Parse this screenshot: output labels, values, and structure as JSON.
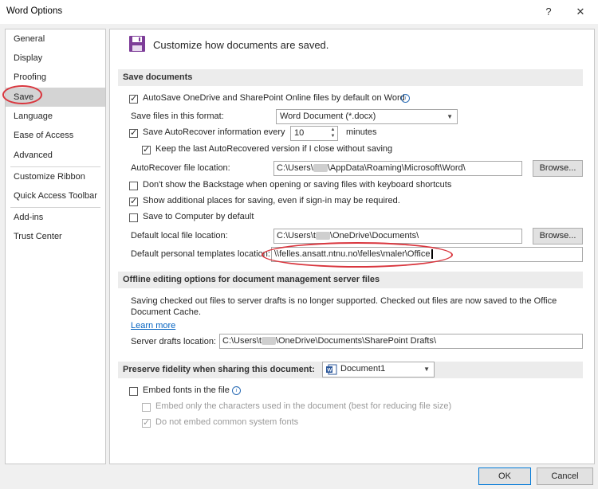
{
  "window": {
    "title": "Word Options",
    "help_glyph": "?",
    "close_glyph": "✕"
  },
  "nav": {
    "items": [
      "General",
      "Display",
      "Proofing",
      "Save",
      "Language",
      "Ease of Access",
      "Advanced",
      "Customize Ribbon",
      "Quick Access Toolbar",
      "Add-ins",
      "Trust Center"
    ],
    "selected": "Save"
  },
  "header": {
    "text": "Customize how documents are saved."
  },
  "save_documents": {
    "section_title": "Save documents",
    "autosave_label": "AutoSave OneDrive and SharePoint Online files by default on Word",
    "format_label": "Save files in this format:",
    "format_value": "Word Document (*.docx)",
    "autorecover_label": "Save AutoRecover information every",
    "autorecover_minutes": "10",
    "minutes_label": "minutes",
    "keep_last_label": "Keep the last AutoRecovered version if I close without saving",
    "autorecover_location_label": "AutoRecover file location:",
    "autorecover_location_prefix": "C:\\Users\\",
    "autorecover_location_suffix": "\\AppData\\Roaming\\Microsoft\\Word\\",
    "browse_label": "Browse...",
    "backstage_label": "Don't show the Backstage when opening or saving files with keyboard shortcuts",
    "additional_places_label": "Show additional places for saving, even if sign-in may be required.",
    "save_to_computer_label": "Save to Computer by default",
    "default_local_label": "Default local file location:",
    "default_local_prefix": "C:\\Users\\t",
    "default_local_suffix": "\\OneDrive\\Documents\\",
    "browse2_label": "Browse...",
    "templates_label": "Default personal templates location:",
    "templates_value": "\\\\felles.ansatt.ntnu.no\\felles\\maler\\Office"
  },
  "offline": {
    "section_title": "Offline editing options for document management server files",
    "notice_line1": "Saving checked out files to server drafts is no longer supported. Checked out files are now saved to the Office",
    "notice_line2": "Document Cache.",
    "learn_more": "Learn more",
    "drafts_label": "Server drafts location:",
    "drafts_prefix": "C:\\Users\\t",
    "drafts_suffix": "\\OneDrive\\Documents\\SharePoint Drafts\\"
  },
  "fidelity": {
    "section_title": "Preserve fidelity when sharing this document:",
    "document": "Document1",
    "embed_fonts_label": "Embed fonts in the file",
    "embed_only_label": "Embed only the characters used in the document (best for reducing file size)",
    "no_common_label": "Do not embed common system fonts"
  },
  "footer": {
    "ok": "OK",
    "cancel": "Cancel"
  },
  "colors": {
    "annotation_red": "#d9363e",
    "link_blue": "#0563c1",
    "save_icon_purple": "#7d3c98"
  }
}
